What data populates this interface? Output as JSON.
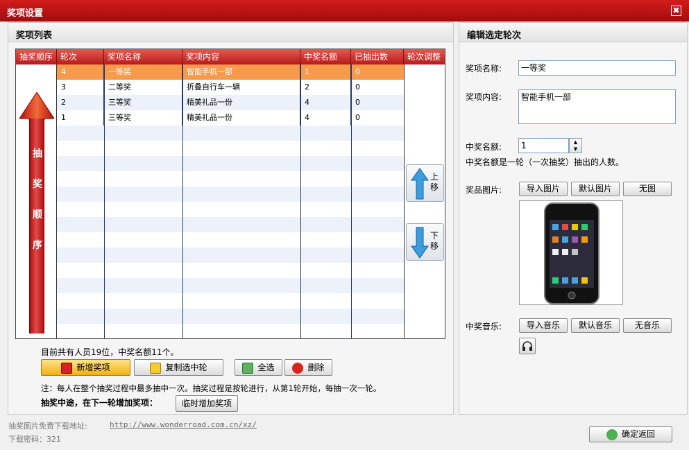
{
  "window": {
    "title": "奖项设置",
    "close_glyph": "✖"
  },
  "left_panel": {
    "header": "奖项列表",
    "columns": [
      "抽奖顺序",
      "轮次",
      "奖项名称",
      "奖项内容",
      "中奖名额",
      "已抽出数",
      "轮次调整"
    ],
    "rows": [
      {
        "round": "4",
        "name": "一等奖",
        "content": "智能手机一部",
        "quota": "1",
        "drawn": "0"
      },
      {
        "round": "3",
        "name": "二等奖",
        "content": "折叠自行车一辆",
        "quota": "2",
        "drawn": "0"
      },
      {
        "round": "2",
        "name": "三等奖",
        "content": "精美礼品一份",
        "quota": "4",
        "drawn": "0"
      },
      {
        "round": "1",
        "name": "三等奖",
        "content": "精美礼品一份",
        "quota": "4",
        "drawn": "0"
      }
    ],
    "arrow_text": [
      "抽",
      "奖",
      "顺",
      "序"
    ],
    "move_up": [
      "上",
      "移"
    ],
    "move_down": [
      "下",
      "移"
    ],
    "summary": "目前共有人员19位，中奖名额11个。",
    "buttons": {
      "add": "新增奖项",
      "copy": "复制选中轮",
      "select_all": "全选",
      "delete": "删除",
      "temp_add": "临时增加奖项"
    },
    "note": "注：每人在整个抽奖过程中最多抽中一次。抽奖过程是按轮进行，从第1轮开始，每抽一次一轮。",
    "mid_draw_label": "抽奖中途，在下一轮增加奖项："
  },
  "right_panel": {
    "header": "编辑选定轮次",
    "name_label": "奖项名称:",
    "name_value": "一等奖",
    "content_label": "奖项内容:",
    "content_value": "智能手机一部",
    "quota_label": "中奖名额:",
    "quota_value": "1",
    "quota_hint": "中奖名额是一轮（一次抽奖）抽出的人数。",
    "image_label": "奖品图片:",
    "image_buttons": [
      "导入图片",
      "默认图片",
      "无图"
    ],
    "music_label": "中奖音乐:",
    "music_buttons": [
      "导入音乐",
      "默认音乐",
      "无音乐"
    ]
  },
  "footer": {
    "download_label": "抽奖图片免费下载地址:",
    "download_url": "http://www.wonderroad.com.cn/xz/",
    "password": "下载密码：321",
    "confirm": "确定返回"
  },
  "colors": {
    "title_red": "#c01414",
    "header_red": "#c62828",
    "selected_row": "#f79a4b",
    "alt_row": "#edf2fa"
  }
}
